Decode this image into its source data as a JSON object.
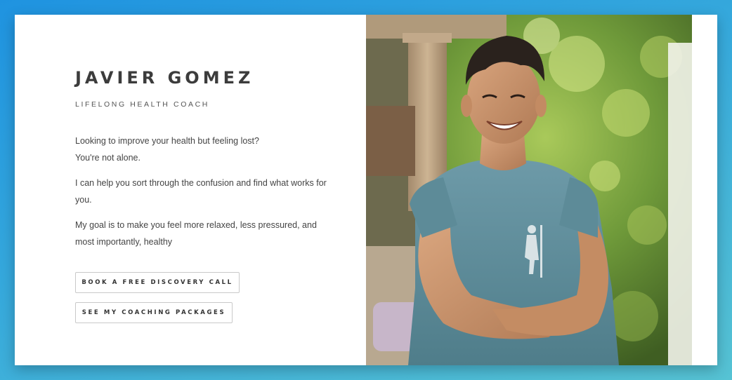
{
  "hero": {
    "name": "JAVIER GOMEZ",
    "subtitle": "LIFELONG HEALTH COACH",
    "paragraphs": [
      {
        "line1": "Looking to improve your health but feeling lost?",
        "line2": "You're not alone."
      },
      {
        "text": "I can help you sort through the confusion and find what works for you."
      },
      {
        "text": "My goal is to make you feel more relaxed, less pressured, and most importantly, healthy"
      }
    ],
    "buttons": {
      "discovery_call": "BOOK A FREE DISCOVERY CALL",
      "packages": "SEE MY COACHING PACKAGES"
    }
  },
  "colors": {
    "background_gradient": [
      "#1f93e0",
      "#56c3d4"
    ],
    "card": "#ffffff",
    "text_dark": "#3c3c3c",
    "button_border": "#c9c9c9",
    "shirt": "#5f8e9c"
  },
  "photo": {
    "subject": "coach-portrait",
    "shirt_logo_icon": "hiker-with-staff-icon"
  }
}
